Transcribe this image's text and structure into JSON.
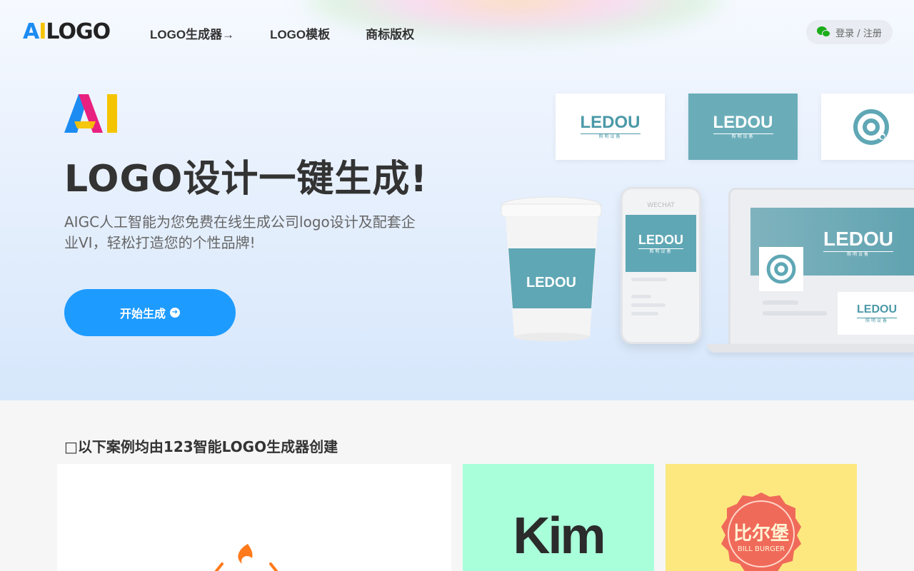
{
  "header": {
    "brand": {
      "a": "A",
      "i": "I",
      "rest": "LOGO"
    },
    "nav": [
      "LOGO生成器→",
      "LOGO模板",
      "商标版权"
    ],
    "login_label": "登录 / 注册"
  },
  "hero": {
    "headline": "LOGO设计一键生成!",
    "subtitle": "AIGC人工智能为您免费在线生成公司logo设计及配套企业VI，轻松打造您的个性品牌!",
    "cta_label": "开始生成",
    "mockup_brand": "LEDOU",
    "mockup_tagline": "照明设备",
    "phone_header": "WECHAT"
  },
  "showcase": {
    "title": "以下案例均由123智能LOGO生成器创建",
    "kim_logo": "Kim",
    "burger_cn": "比尔堡",
    "burger_en": "BILL BURGER"
  },
  "colors": {
    "accent": "#1e9bff",
    "teal": "#6aadb9",
    "mint": "#a9ffda",
    "yellow": "#fce87f",
    "burger_red": "#f06a5a"
  }
}
